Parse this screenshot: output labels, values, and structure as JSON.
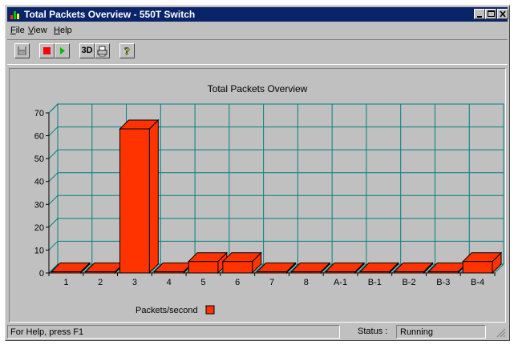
{
  "window": {
    "title": "Total Packets Overview - 550T Switch",
    "icon": "bar-chart-icon",
    "controls": [
      "minimize-icon",
      "maximize-icon",
      "close-icon"
    ]
  },
  "menu": {
    "items": [
      {
        "label": "File",
        "mnemonic": "F"
      },
      {
        "label": "View",
        "mnemonic": "V"
      },
      {
        "label": "Help",
        "mnemonic": "H"
      }
    ]
  },
  "toolbar": {
    "buttons": [
      {
        "name": "save",
        "icon": "floppy-disk-icon",
        "enabled": false
      },
      {
        "name": "stop",
        "icon": "stop-icon",
        "color": "#ff0000"
      },
      {
        "name": "play",
        "icon": "play-icon",
        "color": "#00c000"
      },
      {
        "name": "toggle-3d",
        "label": "3D"
      },
      {
        "name": "print",
        "icon": "printer-icon"
      },
      {
        "name": "help",
        "icon": "question-mark-icon",
        "color": "#ffff00"
      }
    ]
  },
  "chart_data": {
    "type": "bar",
    "style": "3d",
    "title": "Total Packets Overview",
    "categories": [
      "1",
      "2",
      "3",
      "4",
      "5",
      "6",
      "7",
      "8",
      "A-1",
      "B-1",
      "B-2",
      "B-3",
      "B-4"
    ],
    "series": [
      {
        "name": "Packets/second",
        "values": [
          0,
          0,
          63,
          0,
          5,
          5,
          0,
          0,
          0,
          0,
          0,
          0,
          5
        ],
        "color": "#ff3300"
      }
    ],
    "y_ticks": [
      "0",
      "10",
      "20",
      "30",
      "40",
      "50",
      "60",
      "70"
    ],
    "ylim": [
      0,
      70
    ],
    "grid": true,
    "grid_color": "#008080",
    "legend_position": "bottom-left"
  },
  "status": {
    "help_text": "For Help, press F1",
    "label": "Status :",
    "value": "Running"
  }
}
